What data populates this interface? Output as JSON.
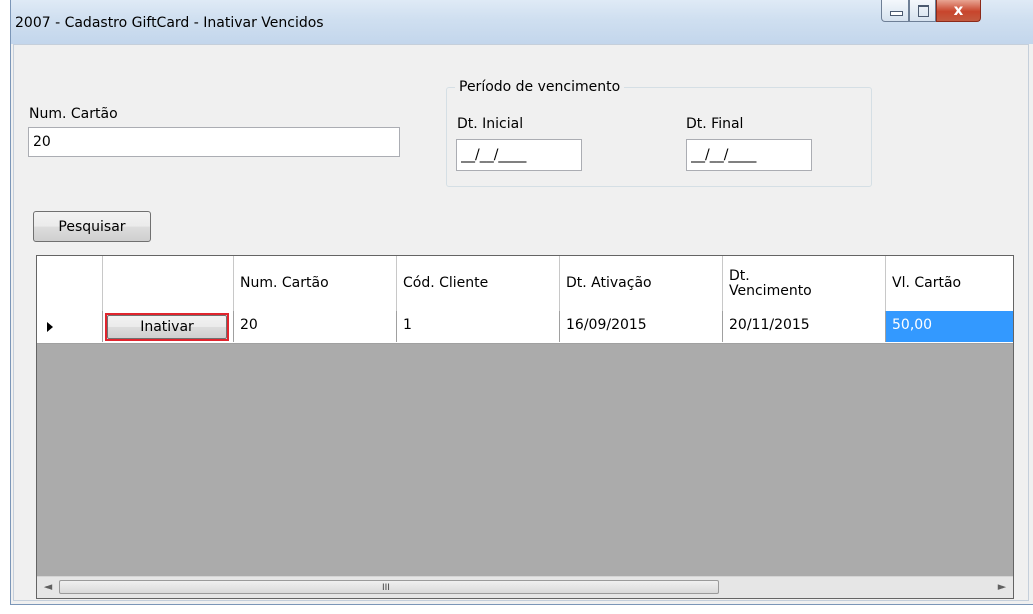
{
  "window": {
    "title": "2007 - Cadastro GiftCard - Inativar Vencidos",
    "close_glyph": "x"
  },
  "form": {
    "num_cartao_label": "Num. Cartão",
    "num_cartao_value": "20",
    "periodo_label": "Período de vencimento",
    "dt_inicial_label": "Dt. Inicial",
    "dt_inicial_value": "__/__/____",
    "dt_final_label": "Dt. Final",
    "dt_final_value": "__/__/____",
    "pesquisar_label": "Pesquisar"
  },
  "grid": {
    "columns": [
      "Num. Cartão",
      "Cód. Cliente",
      "Dt. Ativação",
      "Dt.\nVencimento",
      "Vl. Cartão"
    ],
    "rows": [
      {
        "action_label": "Inativar",
        "num_cartao": "20",
        "cod_cliente": "1",
        "dt_ativacao": "16/09/2015",
        "dt_vencimento": "20/11/2015",
        "vl_cartao": "50,00"
      }
    ],
    "selection_color": "#3399ff",
    "highlight_color": "#e0252e"
  },
  "scrollbar": {
    "left_arrow": "◄",
    "right_arrow": "►",
    "grip": "III"
  }
}
